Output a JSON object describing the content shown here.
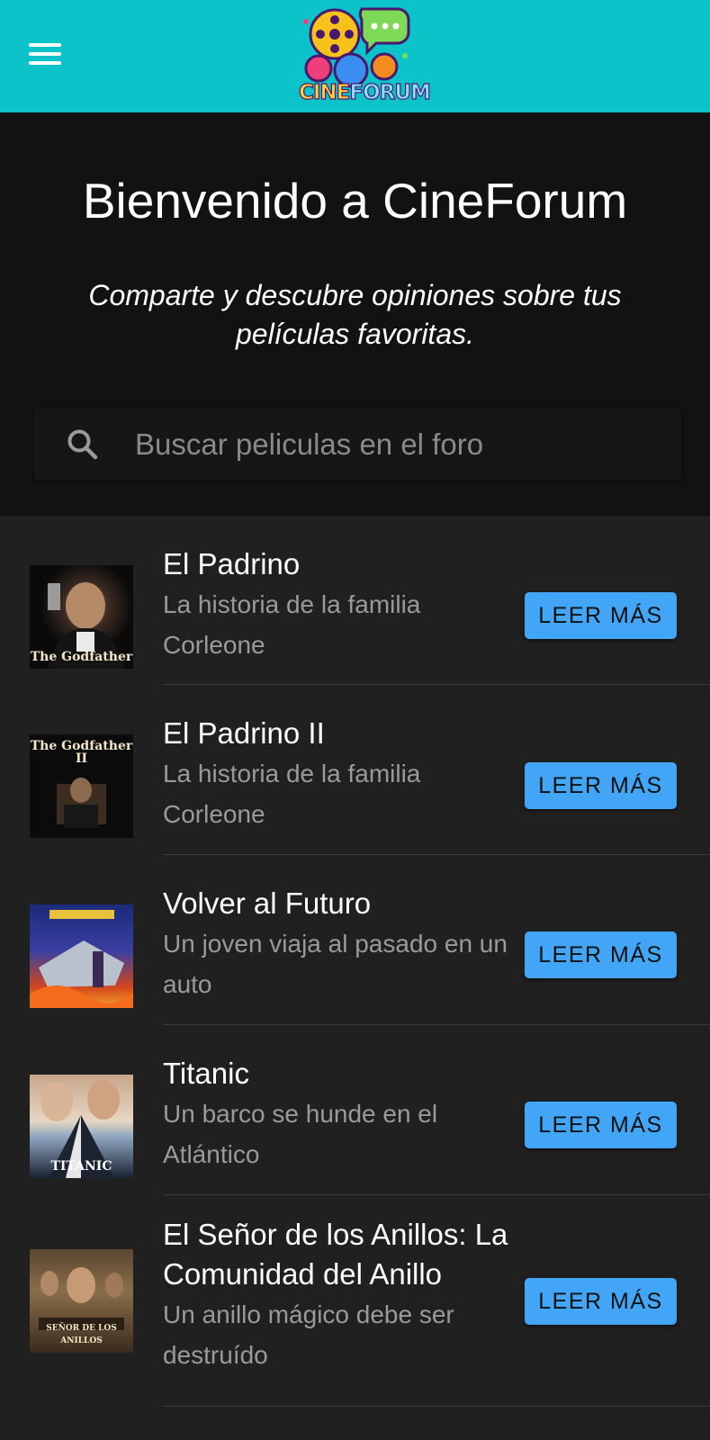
{
  "appbar": {
    "menu_icon": "hamburger-menu-icon",
    "logo_icon": "cineforum-logo",
    "logo_text_part1": "CINE",
    "logo_text_part2": "FORUM",
    "background_color": "#0bc3c8"
  },
  "hero": {
    "title": "Bienvenido a CineForum",
    "subtitle": "Comparte y descubre opiniones sobre tus películas favoritas."
  },
  "search": {
    "icon": "search-icon",
    "placeholder": "Buscar peliculas en el foro",
    "value": ""
  },
  "movies": [
    {
      "title": "El Padrino",
      "description": "La historia de la familia Corleone",
      "button": "LEER MÁS",
      "poster_caption": "The Godfather"
    },
    {
      "title": "El Padrino II",
      "description": "La historia de la familia Corleone",
      "button": "LEER MÁS",
      "poster_caption": "The Godfather II"
    },
    {
      "title": "Volver al Futuro",
      "description": "Un joven viaja al pasado en un auto",
      "button": "LEER MÁS",
      "poster_caption": ""
    },
    {
      "title": "Titanic",
      "description": "Un barco se hunde en el Atlántico",
      "button": "LEER MÁS",
      "poster_caption": "TITANIC"
    },
    {
      "title": "El Señor de los Anillos: La Comunidad del Anillo",
      "description": "Un anillo mágico debe ser destruído",
      "button": "LEER MÁS",
      "poster_caption": "SEÑOR DE LOS ANILLOS"
    }
  ],
  "colors": {
    "button": "#42a5f5",
    "list_background": "#202020",
    "hero_background": "#121212"
  }
}
